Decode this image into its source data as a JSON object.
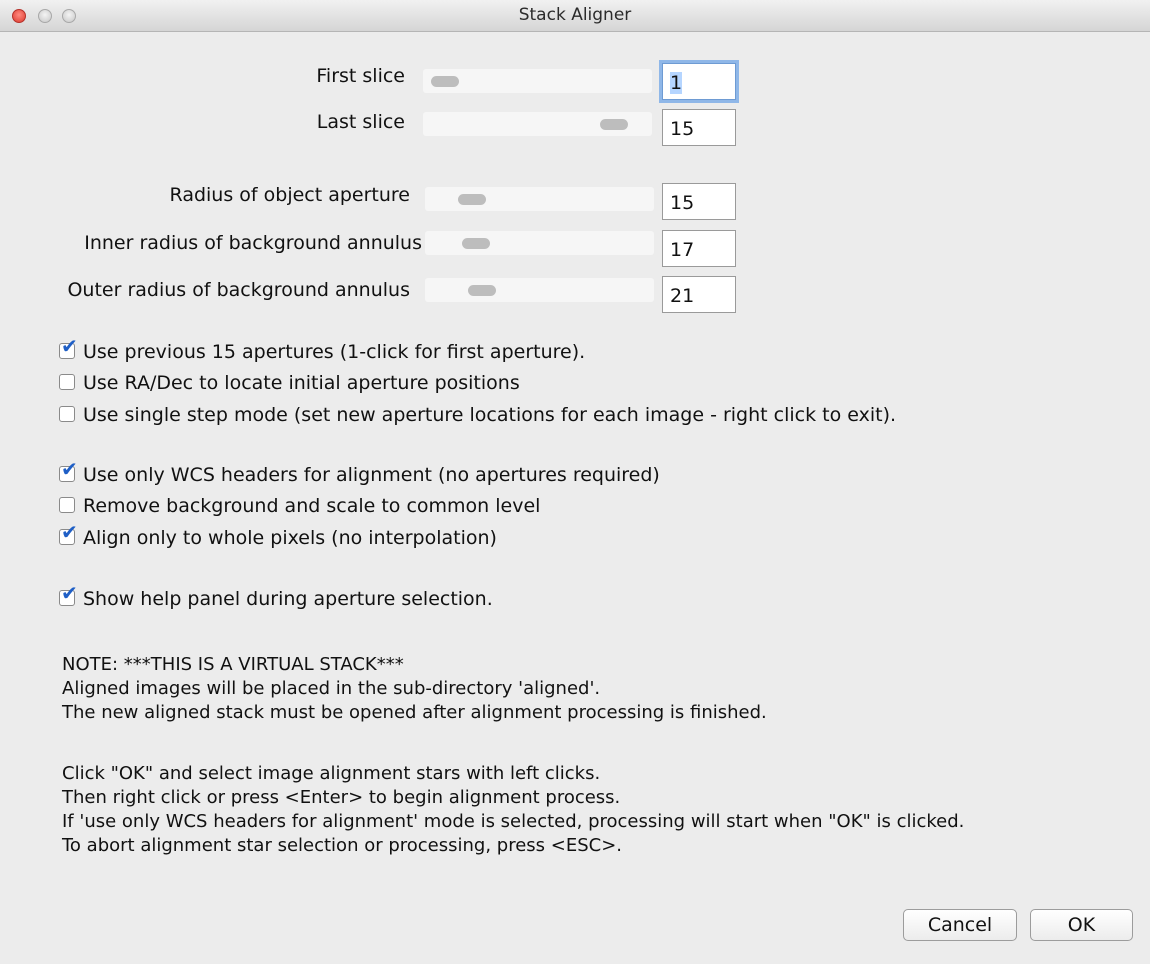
{
  "window": {
    "title": "Stack Aligner"
  },
  "sliders": [
    {
      "label": "First slice",
      "value": "1",
      "level": 0.0
    },
    {
      "label": "Last slice",
      "value": "15",
      "level": 1.0
    },
    {
      "label": "Radius of object aperture",
      "value": "15",
      "level": 0.15
    },
    {
      "label": "Inner radius of background annulus",
      "value": "17",
      "level": 0.17
    },
    {
      "label": "Outer radius of background annulus",
      "value": "21",
      "level": 0.21
    }
  ],
  "options": [
    {
      "label": "Use previous 15 apertures (1-click for first aperture).",
      "checked": true
    },
    {
      "label": "Use RA/Dec to locate initial aperture positions",
      "checked": false
    },
    {
      "label": "Use single step mode (set new aperture locations for each image - right click to exit).",
      "checked": false
    },
    {
      "label": "Use only WCS headers for alignment (no apertures required)",
      "checked": true
    },
    {
      "label": "Remove background and scale to common level",
      "checked": false
    },
    {
      "label": "Align only to whole pixels (no interpolation)",
      "checked": true
    },
    {
      "label": "Show help panel during aperture selection.",
      "checked": true
    }
  ],
  "note": [
    "NOTE: ***THIS IS A VIRTUAL STACK***",
    "Aligned images will be placed in the sub-directory 'aligned'.",
    "The new aligned stack must be opened after alignment processing is finished."
  ],
  "instructions": [
    "Click \"OK\" and select image alignment stars with left clicks.",
    "Then right click or press <Enter> to begin alignment process.",
    "If 'use only WCS headers for alignment' mode is selected, processing will start when \"OK\" is clicked.",
    "To abort alignment star selection or processing, press <ESC>."
  ],
  "buttons": {
    "cancel": "Cancel",
    "ok": "OK"
  },
  "colors": {
    "check_accent": "#1f5fc6",
    "focus_ring": "#8fb7e8"
  }
}
